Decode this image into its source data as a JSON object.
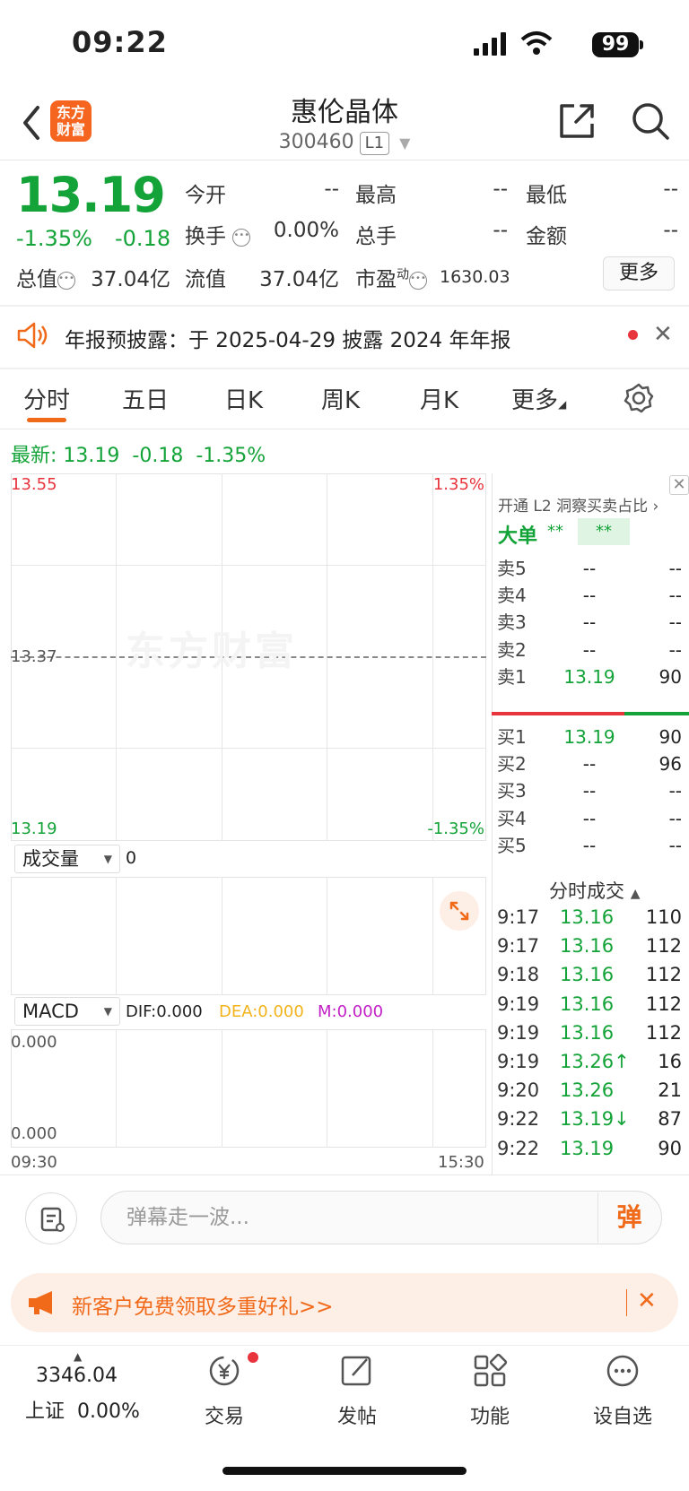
{
  "status_bar": {
    "time": "09:22",
    "battery": "99"
  },
  "header": {
    "logo_line1": "东方",
    "logo_line2": "财富",
    "stock_name": "惠伦晶体",
    "stock_code": "300460",
    "level_badge": "L1"
  },
  "quote": {
    "price": "13.19",
    "change_pct": "-1.35%",
    "change_abs": "-0.18",
    "fields": {
      "open_label": "今开",
      "open_value": "--",
      "high_label": "最高",
      "high_value": "--",
      "low_label": "最低",
      "low_value": "--",
      "turnover_label": "换手",
      "turnover_value": "0.00%",
      "total_hands_label": "总手",
      "total_hands_value": "--",
      "amount_label": "金额",
      "amount_value": "--",
      "market_cap_label": "总值",
      "market_cap_value": "37.04亿",
      "float_cap_label": "流值",
      "float_cap_value": "37.04亿",
      "pe_label": "市盈",
      "pe_sup": "动",
      "pe_value": "1630.03"
    },
    "more_label": "更多"
  },
  "notice": {
    "text": "年报预披露：于 2025-04-29 披露 2024 年年报"
  },
  "tabs": [
    "分时",
    "五日",
    "日K",
    "周K",
    "月K",
    "更多"
  ],
  "chart": {
    "latest_label": "最新:",
    "latest_price": "13.19",
    "latest_chg": "-0.18",
    "latest_pct": "-1.35%",
    "y_top": "13.55",
    "y_mid": "13.37",
    "y_bottom": "13.19",
    "pct_top": "1.35%",
    "pct_bottom": "-1.35%",
    "watermark": "东方财富",
    "volume_label": "成交量",
    "volume_value": "0",
    "macd_label": "MACD",
    "dif": "DIF:0.000",
    "dea": "DEA:0.000",
    "m": "M:0.000",
    "macd_top": "0.000",
    "macd_bottom": "0.000",
    "time_start": "09:30",
    "time_end": "15:30"
  },
  "order_book": {
    "l2_promo": "开通 L2 洞察买卖占比",
    "big_order_label": "大单",
    "big_order_val1": "**",
    "big_order_val2": "**",
    "asks": [
      {
        "label": "卖5",
        "price": "--",
        "vol": "--"
      },
      {
        "label": "卖4",
        "price": "--",
        "vol": "--"
      },
      {
        "label": "卖3",
        "price": "--",
        "vol": "--"
      },
      {
        "label": "卖2",
        "price": "--",
        "vol": "--"
      },
      {
        "label": "卖1",
        "price": "13.19",
        "vol": "90"
      }
    ],
    "bids": [
      {
        "label": "买1",
        "price": "13.19",
        "vol": "90"
      },
      {
        "label": "买2",
        "price": "--",
        "vol": "96"
      },
      {
        "label": "买3",
        "price": "--",
        "vol": "--"
      },
      {
        "label": "买4",
        "price": "--",
        "vol": "--"
      },
      {
        "label": "买5",
        "price": "--",
        "vol": "--"
      }
    ],
    "trades_title": "分时成交",
    "trades": [
      {
        "time": "9:17",
        "price": "13.16",
        "vol": "110"
      },
      {
        "time": "9:17",
        "price": "13.16",
        "vol": "112"
      },
      {
        "time": "9:18",
        "price": "13.16",
        "vol": "112"
      },
      {
        "time": "9:19",
        "price": "13.16",
        "vol": "112"
      },
      {
        "time": "9:19",
        "price": "13.16",
        "vol": "112"
      },
      {
        "time": "9:19",
        "price": "13.26↑",
        "vol": "16"
      },
      {
        "time": "9:20",
        "price": "13.26",
        "vol": "21"
      },
      {
        "time": "9:22",
        "price": "13.19↓",
        "vol": "87"
      },
      {
        "time": "9:22",
        "price": "13.19",
        "vol": "90"
      }
    ]
  },
  "comment": {
    "placeholder": "弹幕走一波...",
    "danmu": "弹"
  },
  "promo": {
    "text": "新客户免费领取多重好礼>>"
  },
  "bottom_nav": {
    "index_value": "3346.04",
    "index_name": "上证",
    "index_pct": "0.00%",
    "items": [
      "交易",
      "发帖",
      "功能",
      "设自选"
    ]
  }
}
